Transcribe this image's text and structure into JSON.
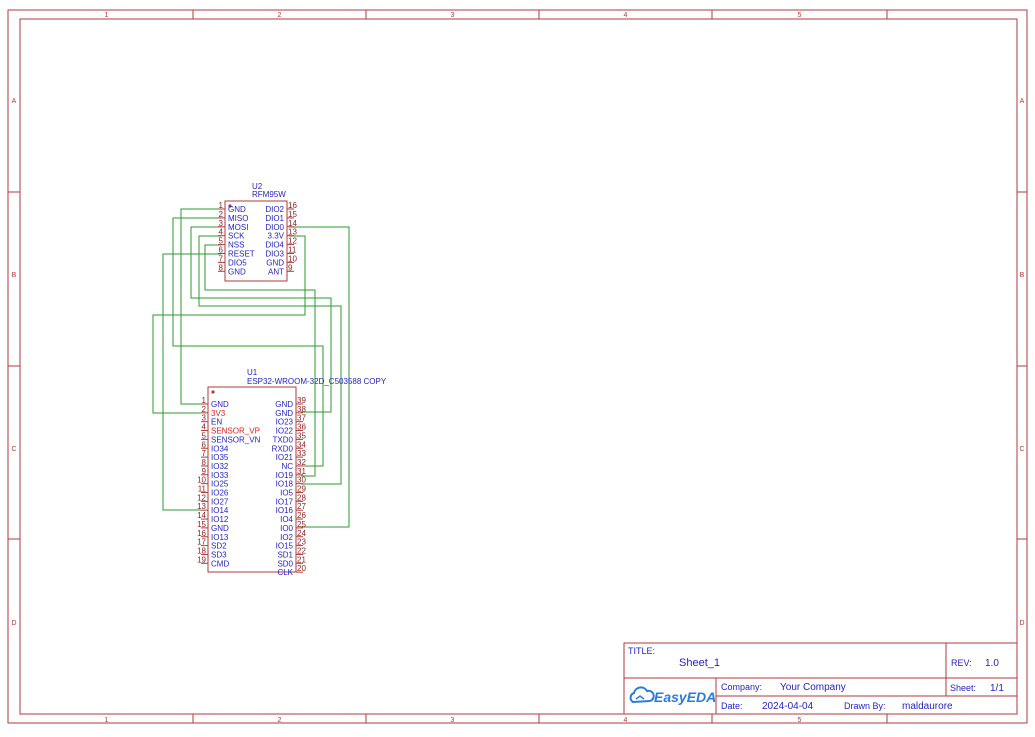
{
  "frame": {
    "columns": [
      "1",
      "2",
      "3",
      "4",
      "5"
    ],
    "rows": [
      "A",
      "B",
      "C",
      "D"
    ]
  },
  "u2": {
    "designator": "U2",
    "part": "RFM95W",
    "left_pins": [
      {
        "num": "1",
        "name": "GND"
      },
      {
        "num": "2",
        "name": "MISO"
      },
      {
        "num": "3",
        "name": "MOSI"
      },
      {
        "num": "4",
        "name": "SCK"
      },
      {
        "num": "5",
        "name": "NSS"
      },
      {
        "num": "6",
        "name": "RESET"
      },
      {
        "num": "7",
        "name": "DIO5"
      },
      {
        "num": "8",
        "name": "GND"
      }
    ],
    "right_pins": [
      {
        "num": "16",
        "name": "DIO2"
      },
      {
        "num": "15",
        "name": "DIO1"
      },
      {
        "num": "14",
        "name": "DIO0"
      },
      {
        "num": "13",
        "name": "3.3V"
      },
      {
        "num": "12",
        "name": "DIO4"
      },
      {
        "num": "11",
        "name": "DIO3"
      },
      {
        "num": "10",
        "name": "GND"
      },
      {
        "num": "9",
        "name": "ANT"
      }
    ]
  },
  "u1": {
    "designator": "U1",
    "part": "ESP32-WROOM-32D_C503588 COPY",
    "left_pins": [
      {
        "num": "1",
        "name": "GND",
        "red": false
      },
      {
        "num": "2",
        "name": "3V3",
        "red": true
      },
      {
        "num": "3",
        "name": "EN",
        "red": false
      },
      {
        "num": "4",
        "name": "SENSOR_VP",
        "red": true
      },
      {
        "num": "5",
        "name": "SENSOR_VN",
        "red": false
      },
      {
        "num": "6",
        "name": "IO34",
        "red": false
      },
      {
        "num": "7",
        "name": "IO35",
        "red": false
      },
      {
        "num": "8",
        "name": "IO32",
        "red": false
      },
      {
        "num": "9",
        "name": "IO33",
        "red": false
      },
      {
        "num": "10",
        "name": "IO25",
        "red": false
      },
      {
        "num": "11",
        "name": "IO26",
        "red": false
      },
      {
        "num": "12",
        "name": "IO27",
        "red": false
      },
      {
        "num": "13",
        "name": "IO14",
        "red": false
      },
      {
        "num": "14",
        "name": "IO12",
        "red": false
      },
      {
        "num": "15",
        "name": "GND",
        "red": false
      },
      {
        "num": "16",
        "name": "IO13",
        "red": false
      },
      {
        "num": "17",
        "name": "SD2",
        "red": false
      },
      {
        "num": "18",
        "name": "SD3",
        "red": false
      },
      {
        "num": "19",
        "name": "CMD",
        "red": false
      }
    ],
    "right_pins": [
      {
        "num": "39",
        "name": "GND"
      },
      {
        "num": "38",
        "name": "GND"
      },
      {
        "num": "37",
        "name": "IO23"
      },
      {
        "num": "36",
        "name": "IO22"
      },
      {
        "num": "35",
        "name": "TXD0"
      },
      {
        "num": "34",
        "name": "RXD0"
      },
      {
        "num": "33",
        "name": "IO21"
      },
      {
        "num": "32",
        "name": "NC"
      },
      {
        "num": "31",
        "name": "IO19"
      },
      {
        "num": "30",
        "name": "IO18"
      },
      {
        "num": "29",
        "name": "IO5"
      },
      {
        "num": "28",
        "name": "IO17"
      },
      {
        "num": "27",
        "name": "IO16"
      },
      {
        "num": "26",
        "name": "IO4"
      },
      {
        "num": "25",
        "name": "IO0"
      },
      {
        "num": "24",
        "name": "IO2"
      },
      {
        "num": "23",
        "name": "IO15"
      },
      {
        "num": "22",
        "name": "SD1"
      },
      {
        "num": "21",
        "name": "SD0"
      },
      {
        "num": "20",
        "name": "CLK"
      }
    ]
  },
  "title_block": {
    "title_label": "TITLE:",
    "title_value": "Sheet_1",
    "rev_label": "REV:",
    "rev_value": "1.0",
    "company_label": "Company:",
    "company_value": "Your Company",
    "sheet_label": "Sheet:",
    "sheet_value": "1/1",
    "date_label": "Date:",
    "date_value": "2024-04-04",
    "drawn_label": "Drawn By:",
    "drawn_value": "maldaurore",
    "logo_text": "EasyEDA"
  },
  "colors": {
    "frame": "#b03a3a",
    "wire": "#2e9a2e",
    "pin_name": "#1f1fbf",
    "pin_num": "#8b1c1c",
    "power_pin": "#e02020",
    "title_text": "#1f1fbf",
    "logo": "#2b7bdc"
  }
}
